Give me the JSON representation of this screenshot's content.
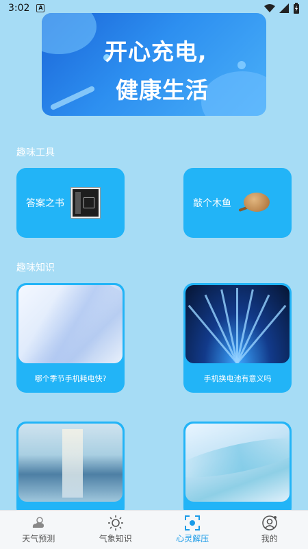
{
  "status_bar": {
    "time": "3:02",
    "notification_letter": "A"
  },
  "banner": {
    "line1": "开心充电,",
    "line2": "健康生活"
  },
  "sections": {
    "tools_title": "趣味工具",
    "knowledge_title": "趣味知识"
  },
  "tools": [
    {
      "label": "答案之书",
      "icon": "book-icon"
    },
    {
      "label": "敲个木鱼",
      "icon": "wooden-fish-icon"
    }
  ],
  "knowledge": [
    {
      "caption": "哪个季节手机耗电快?"
    },
    {
      "caption": "手机换电池有意义吗"
    },
    {
      "caption": ""
    },
    {
      "caption": ""
    }
  ],
  "bottom_nav": {
    "active_index": 2,
    "items": [
      {
        "label": "天气预测",
        "icon": "weather-cloud-icon"
      },
      {
        "label": "气象知识",
        "icon": "sun-icon"
      },
      {
        "label": "心灵解压",
        "icon": "focus-icon"
      },
      {
        "label": "我的",
        "icon": "profile-icon"
      }
    ]
  },
  "colors": {
    "background": "#a6dcf5",
    "card": "#22b4f7",
    "active_nav": "#1a9be8"
  }
}
